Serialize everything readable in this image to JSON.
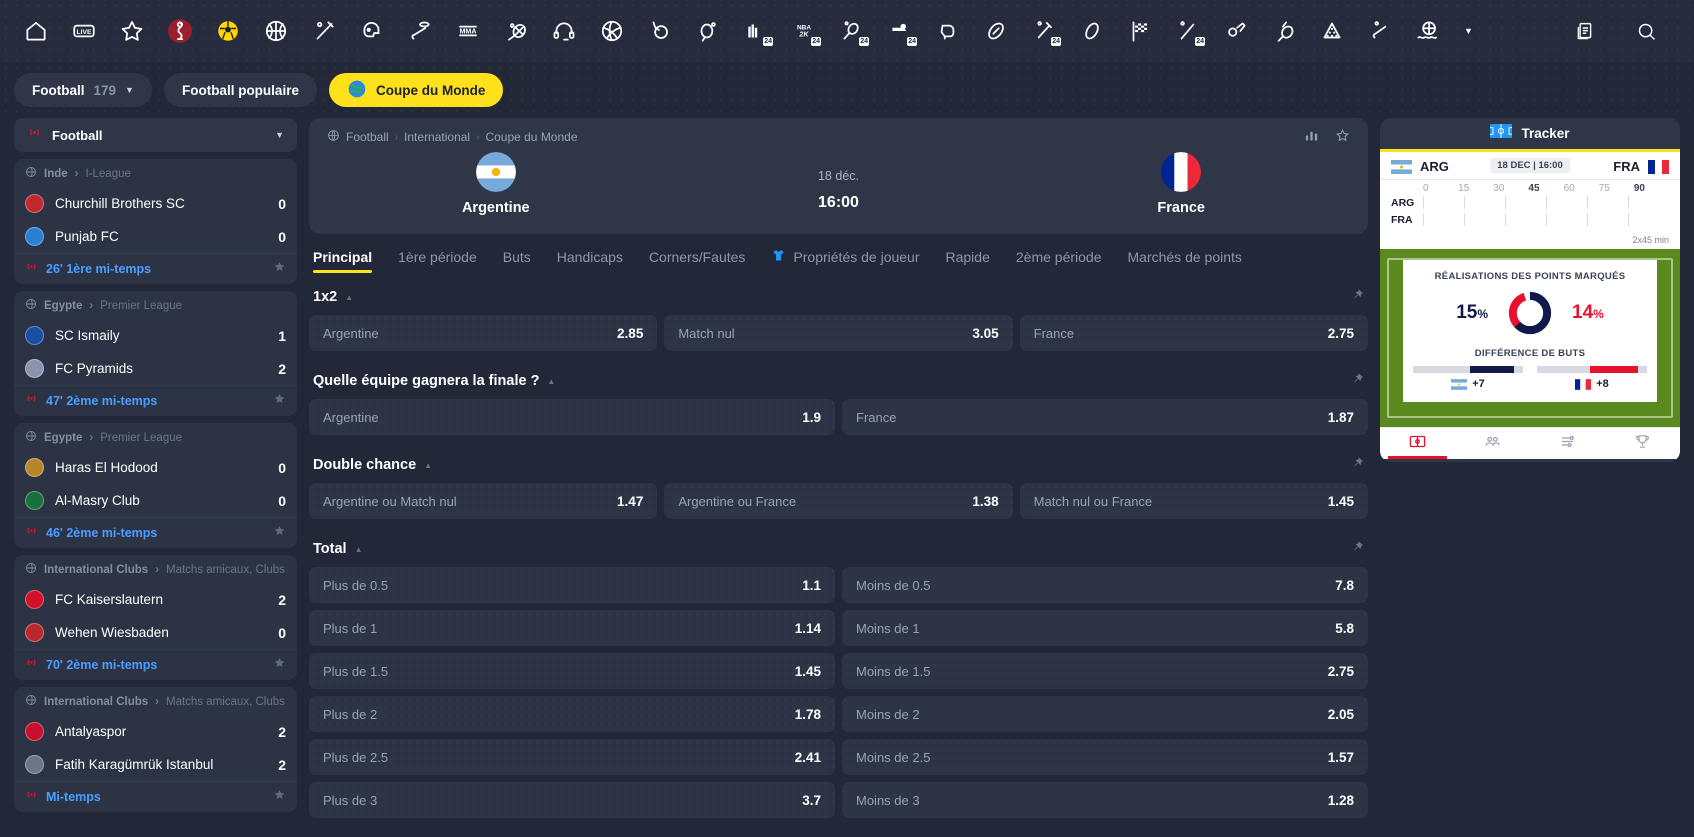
{
  "topnav": {
    "icons": [
      {
        "name": "home-icon",
        "label": "Accueil"
      },
      {
        "name": "live-icon",
        "label": "LIVE"
      },
      {
        "name": "star-icon",
        "label": "Favoris"
      },
      {
        "name": "world-cup-trophy-icon",
        "label": "Coupe du Monde",
        "active": true
      },
      {
        "name": "football-icon",
        "label": "Football",
        "highlight": "yellow"
      },
      {
        "name": "basketball-icon",
        "label": "Basketball"
      },
      {
        "name": "baseball-icon",
        "label": "Baseball"
      },
      {
        "name": "american-football-helmet-icon",
        "label": "Football américain"
      },
      {
        "name": "ice-hockey-icon",
        "label": "Hockey sur glace"
      },
      {
        "name": "mma-icon",
        "label": "MMA"
      },
      {
        "name": "tennis-racket-icon",
        "label": "Tennis"
      },
      {
        "name": "esports-headset-icon",
        "label": "eSports"
      },
      {
        "name": "volleyball-icon",
        "label": "Volleyball"
      },
      {
        "name": "handball-icon",
        "label": "Handball"
      },
      {
        "name": "table-tennis-icon",
        "label": "Tennis de table"
      },
      {
        "name": "fifa-24-icon",
        "label": "FIFA 24",
        "badge": "24"
      },
      {
        "name": "nba-2k24-icon",
        "label": "NBA 2K24",
        "badge": "24"
      },
      {
        "name": "ao-tennis-24-icon",
        "label": "AO Tennis 24",
        "badge": "24"
      },
      {
        "name": "ehockey-24-icon",
        "label": "eHockey 24",
        "badge": "24"
      },
      {
        "name": "boxing-glove-icon",
        "label": "Boxe"
      },
      {
        "name": "rugby-icon",
        "label": "Rugby"
      },
      {
        "name": "cricket-24-icon",
        "label": "Cricket 24",
        "badge": "24"
      },
      {
        "name": "aussie-rules-icon",
        "label": "Football australien"
      },
      {
        "name": "motorsport-flag-icon",
        "label": "Sports mécaniques"
      },
      {
        "name": "cricket-bat-24-icon",
        "label": "Cricket",
        "badge": "24"
      },
      {
        "name": "futsal-icon",
        "label": "Futsal"
      },
      {
        "name": "badminton-icon",
        "label": "Badminton"
      },
      {
        "name": "snooker-icon",
        "label": "Snooker"
      },
      {
        "name": "floorball-icon",
        "label": "Floorball"
      },
      {
        "name": "water-polo-icon",
        "label": "Water-polo"
      }
    ],
    "more_label": "Plus",
    "right_icons": [
      {
        "name": "betslip-icon",
        "label": "Coupon"
      },
      {
        "name": "search-icon",
        "label": "Rechercher"
      }
    ]
  },
  "chips": [
    {
      "label": "Football",
      "count": "179",
      "type": "dropdown"
    },
    {
      "label": "Football populaire",
      "type": "plain"
    },
    {
      "label": "Coupe du Monde",
      "type": "active",
      "icon": "globe-icon"
    }
  ],
  "sidebar": {
    "header": {
      "label": "Football",
      "icon": "live-broadcast-icon"
    },
    "matches": [
      {
        "league": "Inde",
        "league_sub": "I-League",
        "teams": [
          {
            "name": "Churchill Brothers SC",
            "score": "0",
            "logo": "#c1282d"
          },
          {
            "name": "Punjab FC",
            "score": "0",
            "logo": "#2a7fd4"
          }
        ],
        "status": "26' 1ère mi-temps"
      },
      {
        "league": "Egypte",
        "league_sub": "Premier League",
        "teams": [
          {
            "name": "SC Ismaily",
            "score": "1",
            "logo": "#1c4fa1"
          },
          {
            "name": "FC Pyramids",
            "score": "2",
            "logo": "#8795ad"
          }
        ],
        "status": "47' 2ème mi-temps"
      },
      {
        "league": "Egypte",
        "league_sub": "Premier League",
        "teams": [
          {
            "name": "Haras El Hodood",
            "score": "0",
            "logo": "#b8862a"
          },
          {
            "name": "Al-Masry Club",
            "score": "0",
            "logo": "#18703a"
          }
        ],
        "status": "46' 2ème mi-temps"
      },
      {
        "league": "International Clubs",
        "league_sub": "Matchs amicaux, Clubs",
        "teams": [
          {
            "name": "FC Kaiserslautern",
            "score": "2",
            "logo": "#d2102a"
          },
          {
            "name": "Wehen Wiesbaden",
            "score": "0",
            "logo": "#b9282d"
          }
        ],
        "status": "70' 2ème mi-temps"
      },
      {
        "league": "International Clubs",
        "league_sub": "Matchs amicaux, Clubs",
        "teams": [
          {
            "name": "Antalyaspor",
            "score": "2",
            "logo": "#c8102e"
          },
          {
            "name": "Fatih Karagümrük Istanbul",
            "score": "2",
            "logo": "#6d7588"
          }
        ],
        "status": "Mi-temps"
      }
    ]
  },
  "match": {
    "breadcrumb": [
      "Football",
      "International",
      "Coupe du Monde"
    ],
    "home_team": "Argentine",
    "away_team": "France",
    "date": "18 déc.",
    "time": "16:00"
  },
  "tabs": [
    {
      "label": "Principal",
      "active": true
    },
    {
      "label": "1ère période"
    },
    {
      "label": "Buts"
    },
    {
      "label": "Handicaps"
    },
    {
      "label": "Corners/Fautes"
    },
    {
      "label": "Propriétés de joueur",
      "icon": "jersey-icon"
    },
    {
      "label": "Rapide"
    },
    {
      "label": "2ème période"
    },
    {
      "label": "Marchés de points"
    }
  ],
  "markets": [
    {
      "title": "1x2",
      "rows": [
        [
          {
            "label": "Argentine",
            "odds": "2.85"
          },
          {
            "label": "Match nul",
            "odds": "3.05"
          },
          {
            "label": "France",
            "odds": "2.75"
          }
        ]
      ]
    },
    {
      "title": "Quelle équipe gagnera la finale ?",
      "rows": [
        [
          {
            "label": "Argentine",
            "odds": "1.9"
          },
          {
            "label": "France",
            "odds": "1.87"
          }
        ]
      ]
    },
    {
      "title": "Double chance",
      "rows": [
        [
          {
            "label": "Argentine ou Match nul",
            "odds": "1.47"
          },
          {
            "label": "Argentine ou France",
            "odds": "1.38"
          },
          {
            "label": "Match nul ou France",
            "odds": "1.45"
          }
        ]
      ]
    },
    {
      "title": "Total",
      "rows": [
        [
          {
            "label": "Plus de 0.5",
            "odds": "1.1"
          },
          {
            "label": "Moins de 0.5",
            "odds": "7.8"
          }
        ],
        [
          {
            "label": "Plus de 1",
            "odds": "1.14"
          },
          {
            "label": "Moins de 1",
            "odds": "5.8"
          }
        ],
        [
          {
            "label": "Plus de 1.5",
            "odds": "1.45"
          },
          {
            "label": "Moins de 1.5",
            "odds": "2.75"
          }
        ],
        [
          {
            "label": "Plus de 2",
            "odds": "1.78"
          },
          {
            "label": "Moins de 2",
            "odds": "2.05"
          }
        ],
        [
          {
            "label": "Plus de 2.5",
            "odds": "2.41"
          },
          {
            "label": "Moins de 2.5",
            "odds": "1.57"
          }
        ],
        [
          {
            "label": "Plus de 3",
            "odds": "3.7"
          },
          {
            "label": "Moins de 3",
            "odds": "1.28"
          }
        ]
      ]
    }
  ],
  "tracker": {
    "title": "Tracker",
    "home_abbr": "ARG",
    "away_abbr": "FRA",
    "datetime_badge": "18 DEC | 16:00",
    "timeline_ticks": [
      "0",
      "15",
      "30",
      "45",
      "60",
      "75",
      "90"
    ],
    "duration_note": "2x45 min",
    "stats": {
      "title": "RÉALISATIONS DES POINTS MARQUÉS",
      "home_pct": "15",
      "away_pct": "14",
      "pct_symbol": "%",
      "goal_diff_title": "DIFFÉRENCE DE BUTS",
      "home_goal_diff": "+7",
      "away_goal_diff": "+8",
      "home_color": "#10194a",
      "away_color": "#e8112d"
    },
    "tabs": [
      {
        "name": "pitch-icon",
        "active": true
      },
      {
        "name": "lineups-icon",
        "active": false
      },
      {
        "name": "stats-list-icon",
        "active": false
      },
      {
        "name": "trophy-icon",
        "active": false
      }
    ]
  }
}
